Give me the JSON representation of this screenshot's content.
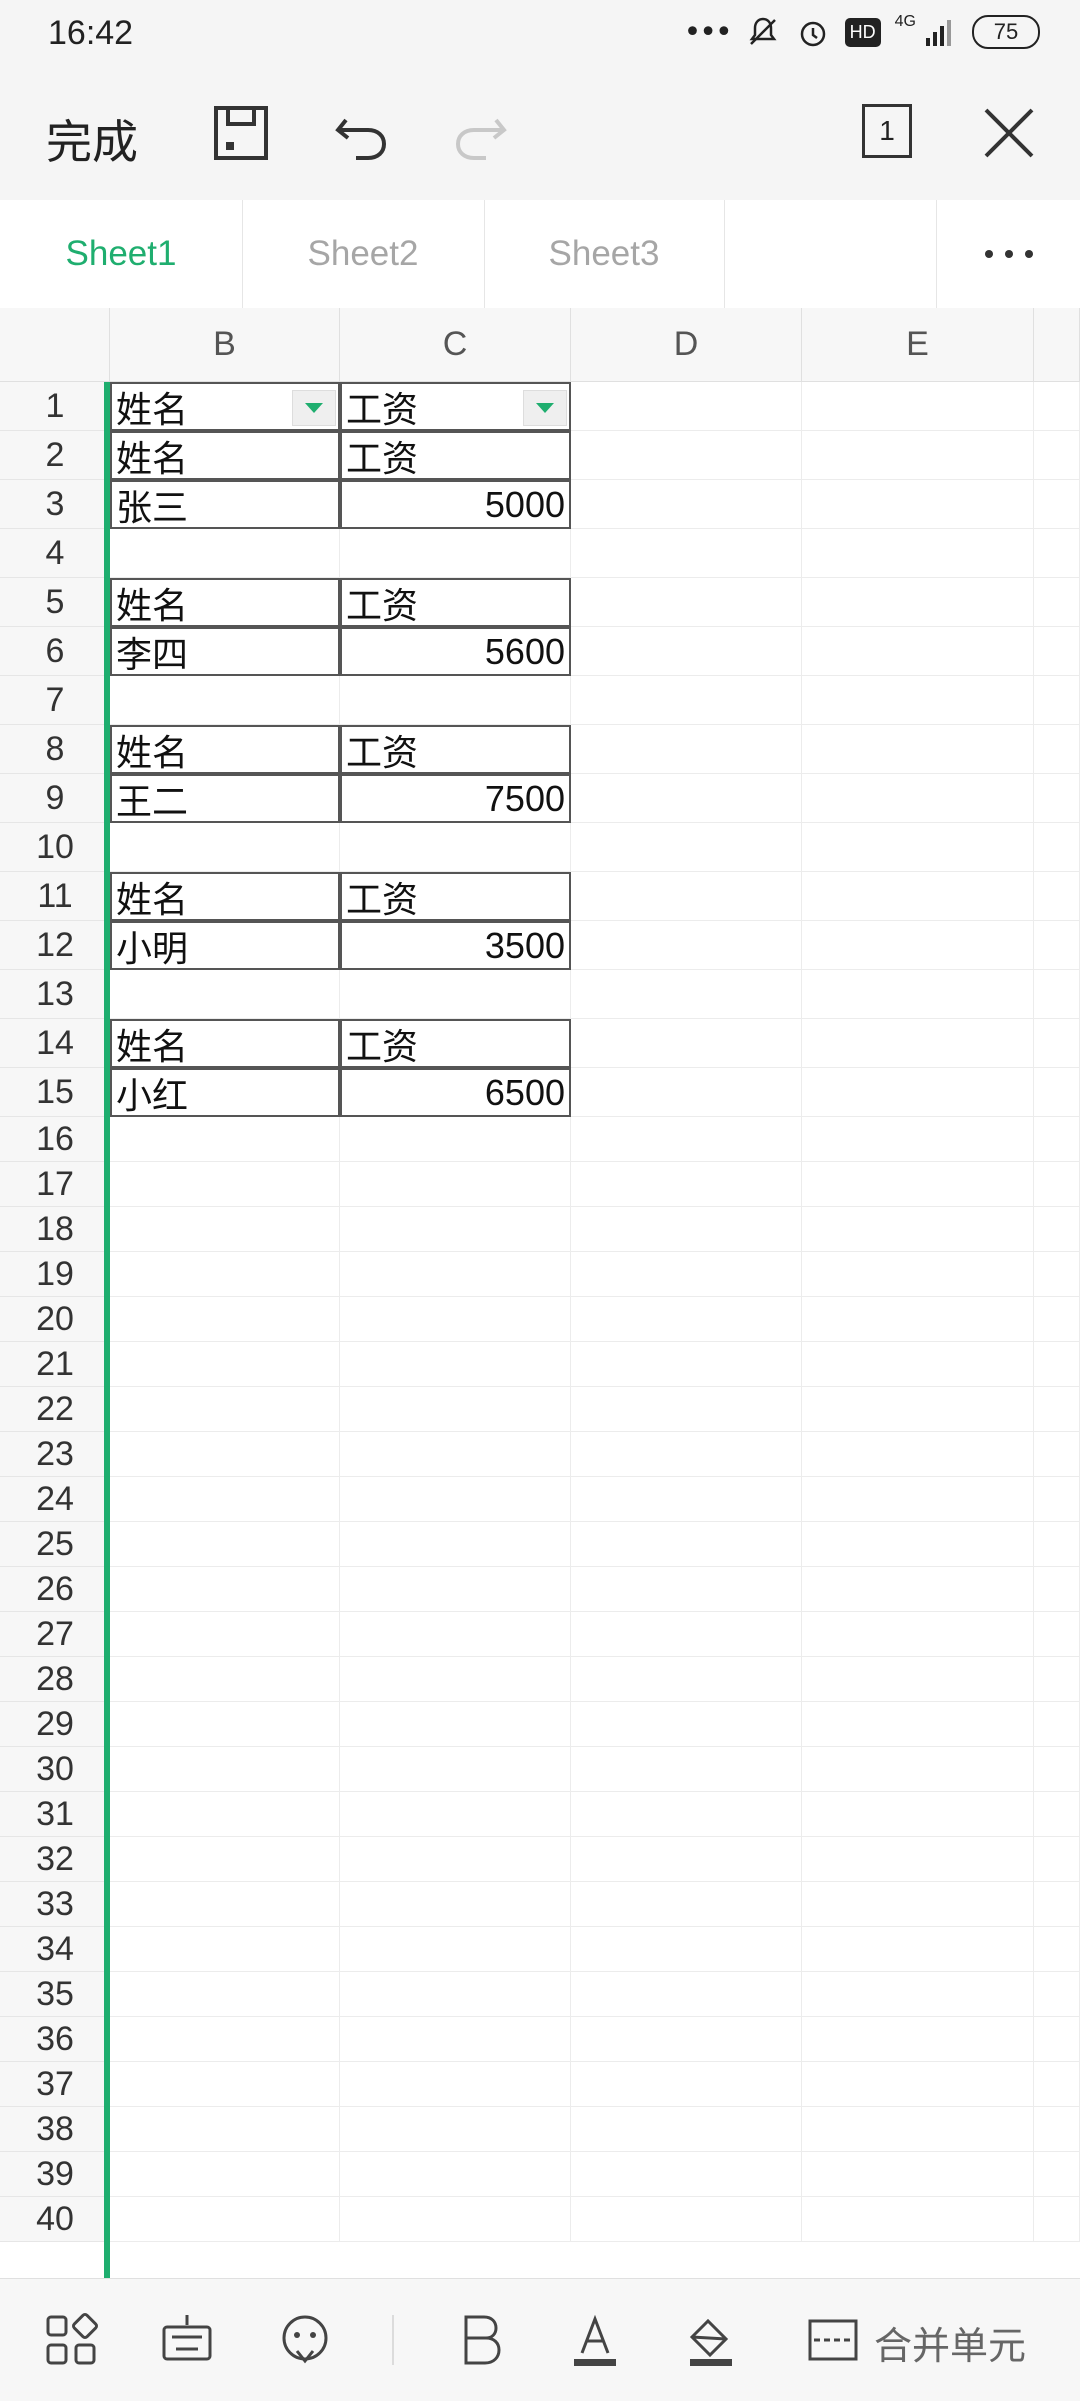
{
  "status_bar": {
    "time": "16:42",
    "network": "4G",
    "hd_badge": "HD",
    "battery": "75"
  },
  "toolbar": {
    "done_label": "完成",
    "page_count": "1"
  },
  "sheet_tabs": [
    {
      "label": "Sheet1",
      "active": true
    },
    {
      "label": "Sheet2",
      "active": false
    },
    {
      "label": "Sheet3",
      "active": false
    }
  ],
  "columns": [
    "B",
    "C",
    "D",
    "E"
  ],
  "rows": [
    "1",
    "2",
    "3",
    "4",
    "5",
    "6",
    "7",
    "8",
    "9",
    "10",
    "11",
    "12",
    "13",
    "14",
    "15",
    "16",
    "17",
    "18",
    "19",
    "20",
    "21",
    "22",
    "23",
    "24",
    "25",
    "26",
    "27",
    "28",
    "29",
    "30",
    "31",
    "32",
    "33",
    "34",
    "35",
    "36",
    "37",
    "38",
    "39",
    "40"
  ],
  "cells": {
    "r1": {
      "b": "姓名",
      "c": "工资"
    },
    "r2": {
      "b": "姓名",
      "c": "工资"
    },
    "r3": {
      "b": "张三",
      "c": "5000"
    },
    "r5": {
      "b": "姓名",
      "c": "工资"
    },
    "r6": {
      "b": "李四",
      "c": "5600"
    },
    "r8": {
      "b": "姓名",
      "c": "工资"
    },
    "r9": {
      "b": "王二",
      "c": "7500"
    },
    "r11": {
      "b": "姓名",
      "c": "工资"
    },
    "r12": {
      "b": "小明",
      "c": "3500"
    },
    "r14": {
      "b": "姓名",
      "c": "工资"
    },
    "r15": {
      "b": "小红",
      "c": "6500"
    }
  },
  "bottom_toolbar": {
    "merge_cells_label": "合并单元"
  },
  "colors": {
    "accent": "#1fae6f"
  }
}
